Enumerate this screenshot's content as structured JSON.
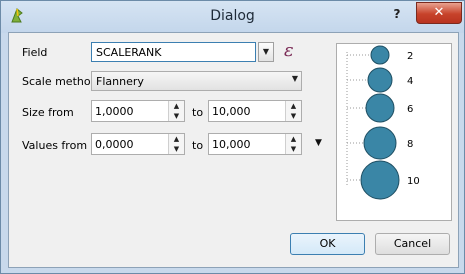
{
  "window": {
    "title": "Dialog",
    "help_label": "?",
    "close_label": "✕"
  },
  "form": {
    "field_label": "Field",
    "field_value": "SCALERANK",
    "expression_symbol": "ε",
    "scale_method_label": "Scale method",
    "scale_method_value": "Flannery",
    "size_from_label": "Size from",
    "size_from_value": "1,0000",
    "size_to_label": "to",
    "size_to_value": "10,000",
    "values_from_label": "Values from",
    "values_from_value": "0,0000",
    "values_to_label": "to",
    "values_to_value": "10,000"
  },
  "legend": {
    "items": [
      "2",
      "4",
      "6",
      "8",
      "10"
    ],
    "color": "#3a86a6"
  },
  "buttons": {
    "ok_label": "OK",
    "cancel_label": "Cancel"
  }
}
